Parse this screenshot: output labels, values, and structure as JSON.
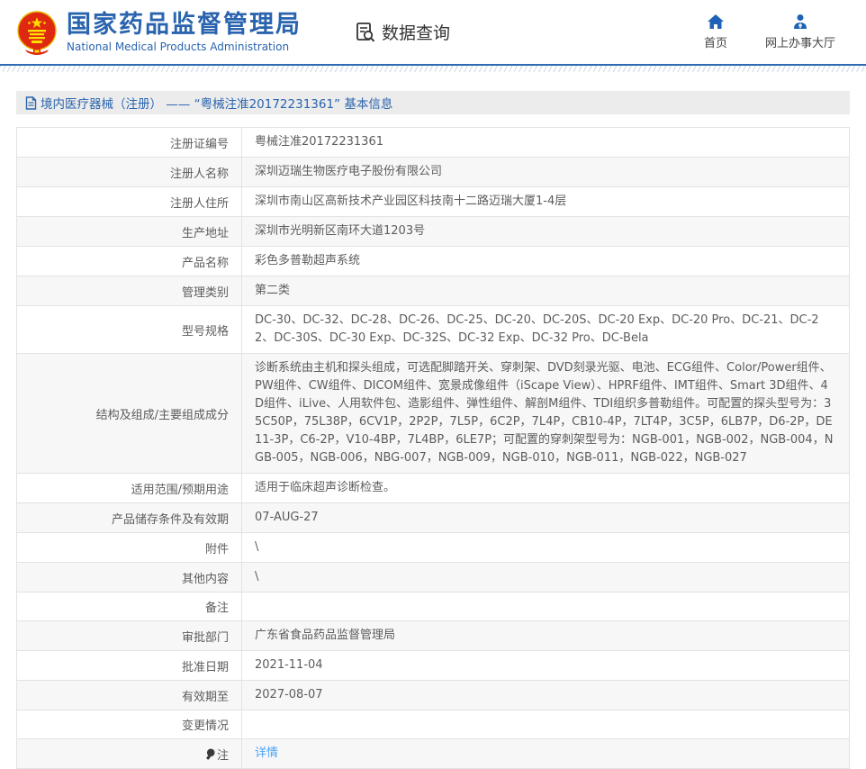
{
  "header": {
    "title_cn": "国家药品监督管理局",
    "title_en": "National Medical Products Administration",
    "data_query_label": "数据查询",
    "nav": [
      {
        "label": "首页",
        "icon": "home-icon"
      },
      {
        "label": "网上办事大厅",
        "icon": "person-icon"
      }
    ]
  },
  "page": {
    "section_title": "境内医疗器械（注册） —— “粤械注准20172231361” 基本信息"
  },
  "colors": {
    "brand_blue": "#2a64ae",
    "rule_blue": "#2e6bb4",
    "link_blue": "#4ba3f5",
    "emblem_red": "#de2910",
    "emblem_yellow": "#ffde00",
    "row_alt_gray": "#f7f7f7",
    "section_bar_gray": "#ececec"
  },
  "table": {
    "rows": [
      {
        "label": "注册证编号",
        "value": "粤械注准20172231361"
      },
      {
        "label": "注册人名称",
        "value": "深圳迈瑞生物医疗电子股份有限公司"
      },
      {
        "label": "注册人住所",
        "value": "深圳市南山区高新技术产业园区科技南十二路迈瑞大厦1-4层"
      },
      {
        "label": "生产地址",
        "value": "深圳市光明新区南环大道1203号"
      },
      {
        "label": "产品名称",
        "value": "彩色多普勒超声系统"
      },
      {
        "label": "管理类别",
        "value": "第二类"
      },
      {
        "label": "型号规格",
        "value": "DC-30、DC-32、DC-28、DC-26、DC-25、DC-20、DC-20S、DC-20 Exp、DC-20 Pro、DC-21、DC-22、DC-30S、DC-30 Exp、DC-32S、DC-32 Exp、DC-32 Pro、DC-Bela"
      },
      {
        "label": "结构及组成/主要组成成分",
        "value": "诊断系统由主机和探头组成，可选配脚踏开关、穿刺架、DVD刻录光驱、电池、ECG组件、Color/Power组件、PW组件、CW组件、DICOM组件、宽景成像组件（iScape View）、HPRF组件、IMT组件、Smart 3D组件、4D组件、iLive、人用软件包、造影组件、弹性组件、解剖M组件、TDI组织多普勒组件。可配置的探头型号为：35C50P，75L38P，6CV1P，2P2P，7L5P，6C2P，7L4P，CB10-4P，7LT4P，3C5P，6LB7P，D6-2P，DE11-3P，C6-2P，V10-4BP，7L4BP，6LE7P；可配置的穿刺架型号为：NGB-001，NGB-002，NGB-004，NGB-005，NGB-006，NBG-007，NGB-009，NGB-010，NGB-011，NGB-022，NGB-027"
      },
      {
        "label": "适用范围/预期用途",
        "value": "适用于临床超声诊断检查。"
      },
      {
        "label": "产品储存条件及有效期",
        "value": "07-AUG-27"
      },
      {
        "label": "附件",
        "value": "\\"
      },
      {
        "label": "其他内容",
        "value": "\\"
      },
      {
        "label": "备注",
        "value": ""
      },
      {
        "label": "审批部门",
        "value": "广东省食品药品监督管理局"
      },
      {
        "label": "批准日期",
        "value": "2021-11-04"
      },
      {
        "label": "有效期至",
        "value": "2027-08-07"
      },
      {
        "label": "变更情况",
        "value": ""
      },
      {
        "label": "注",
        "label_icon": "bulb-icon",
        "value": "详情",
        "value_type": "link"
      }
    ]
  }
}
